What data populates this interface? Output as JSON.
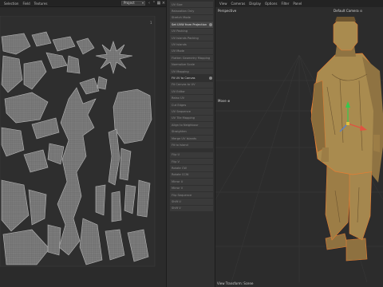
{
  "uv_editor": {
    "menu": [
      "Selection",
      "Field",
      "Textures"
    ],
    "projection_select": "Project",
    "tool_icons": [
      "arrow-left-icon",
      "arrow-up-icon",
      "grid-icon",
      "close-icon"
    ]
  },
  "panel": {
    "rows": [
      {
        "label": "UV Size",
        "style": "normal"
      },
      {
        "label": "Relaxation Only",
        "style": "normal"
      },
      {
        "label": "Stretch Mode",
        "style": "normal"
      },
      {
        "label": "Set UVW from Projection",
        "style": "highlight"
      },
      {
        "label": "UV Packing",
        "style": "normal"
      },
      {
        "label": "UV Islands Packing",
        "style": "normal"
      },
      {
        "label": "UV Islands",
        "style": "normal"
      },
      {
        "label": "UV Mode",
        "style": "normal"
      },
      {
        "label": "Flatten Geometry Mapping",
        "style": "normal"
      },
      {
        "label": "Normalize Scale",
        "style": "normal"
      },
      {
        "label": "UV Mapping",
        "style": "gap"
      },
      {
        "label": "Fit UV to Canvas",
        "style": "head"
      },
      {
        "label": "Fit Canvas to UV",
        "style": "normal"
      },
      {
        "label": "UV Editor",
        "style": "normal"
      },
      {
        "label": "Relax UV",
        "style": "normal"
      },
      {
        "label": "Cut Edges",
        "style": "normal"
      },
      {
        "label": "UV Sequence",
        "style": "normal"
      },
      {
        "label": "UV Tile Mapping",
        "style": "normal"
      },
      {
        "label": "Align to Neighbour",
        "style": "normal"
      },
      {
        "label": "Straighten",
        "style": "normal"
      },
      {
        "label": "Merge UV Islands",
        "style": "normal"
      },
      {
        "label": "Fit to Island",
        "style": "normal"
      },
      {
        "label": "",
        "style": "gap"
      },
      {
        "label": "Flip U",
        "style": "normal"
      },
      {
        "label": "Flip V",
        "style": "normal"
      },
      {
        "label": "Rotate CW",
        "style": "normal"
      },
      {
        "label": "Rotate CCW",
        "style": "normal"
      },
      {
        "label": "Mirror U",
        "style": "normal"
      },
      {
        "label": "Mirror V",
        "style": "normal"
      },
      {
        "label": "Flip Sequence",
        "style": "normal"
      },
      {
        "label": "Shift U",
        "style": "normal"
      },
      {
        "label": "Shift V",
        "style": "normal"
      }
    ]
  },
  "viewport": {
    "menu": [
      "View",
      "Cameras",
      "Display",
      "Options",
      "Filter",
      "Panel"
    ],
    "perspective_label": "Perspective",
    "camera_label": "Default Camera ⊙",
    "move_label": "Move ⊕",
    "footer": "View Transform: Scene"
  },
  "colors": {
    "statue": "#a98b4f",
    "statue_shadow": "#6d5530",
    "uv_fill": "#7d7d7d",
    "uv_line": "#b4b4b4",
    "selection": "#e57d32",
    "gizmo_green": "#36c94e",
    "gizmo_red": "#e05340",
    "gizmo_blue": "#4d7fe0"
  }
}
